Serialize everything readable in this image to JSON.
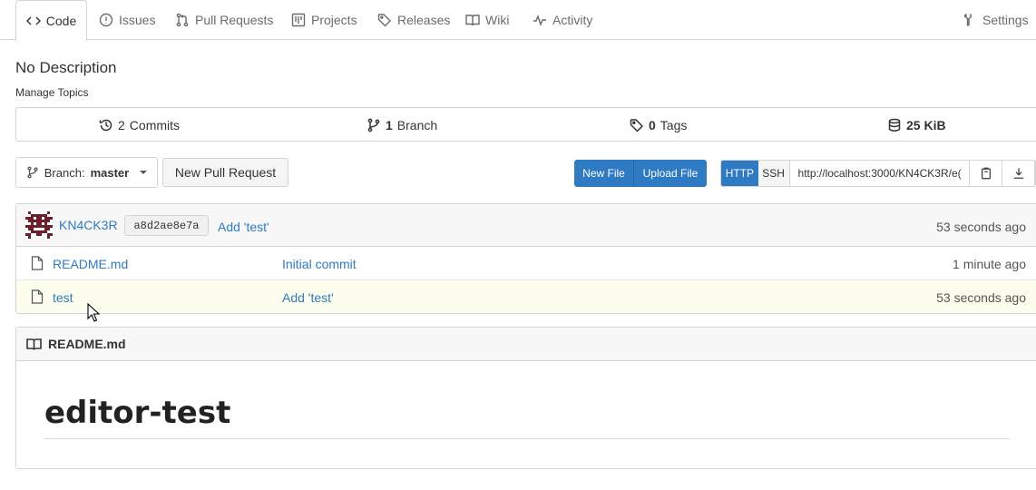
{
  "tabs": [
    {
      "label": "Code",
      "icon": "code-icon"
    },
    {
      "label": "Issues",
      "icon": "issues-icon"
    },
    {
      "label": "Pull Requests",
      "icon": "pull-request-icon"
    },
    {
      "label": "Projects",
      "icon": "projects-icon"
    },
    {
      "label": "Releases",
      "icon": "tag-icon"
    },
    {
      "label": "Wiki",
      "icon": "book-icon"
    },
    {
      "label": "Activity",
      "icon": "pulse-icon"
    }
  ],
  "settings_label": "Settings",
  "description": "No Description",
  "manage_topics": "Manage Topics",
  "stats": {
    "commits_count": "2",
    "commits_label": "Commits",
    "branch_count": "1",
    "branch_label": "Branch",
    "tags_count": "0",
    "tags_label": "Tags",
    "size": "25 KiB"
  },
  "toolbar": {
    "branch_prefix": "Branch:",
    "branch_name": "master",
    "new_pull_request": "New Pull Request",
    "new_file": "New File",
    "upload_file": "Upload File",
    "http": "HTTP",
    "ssh": "SSH",
    "clone_url": "http://localhost:3000/KN4CK3R/e("
  },
  "latest_commit": {
    "author": "KN4CK3R",
    "sha": "a8d2ae8e7a",
    "message": "Add 'test'",
    "time": "53 seconds ago"
  },
  "files": [
    {
      "name": "README.md",
      "message": "Initial commit",
      "time": "1 minute ago"
    },
    {
      "name": "test",
      "message": "Add 'test'",
      "time": "53 seconds ago"
    }
  ],
  "readme": {
    "filename": "README.md",
    "title": "editor-test"
  },
  "colors": {
    "accent": "#2e7bc4",
    "highlight_row": "#fdfdee",
    "avatar": "#6b1f2a"
  }
}
